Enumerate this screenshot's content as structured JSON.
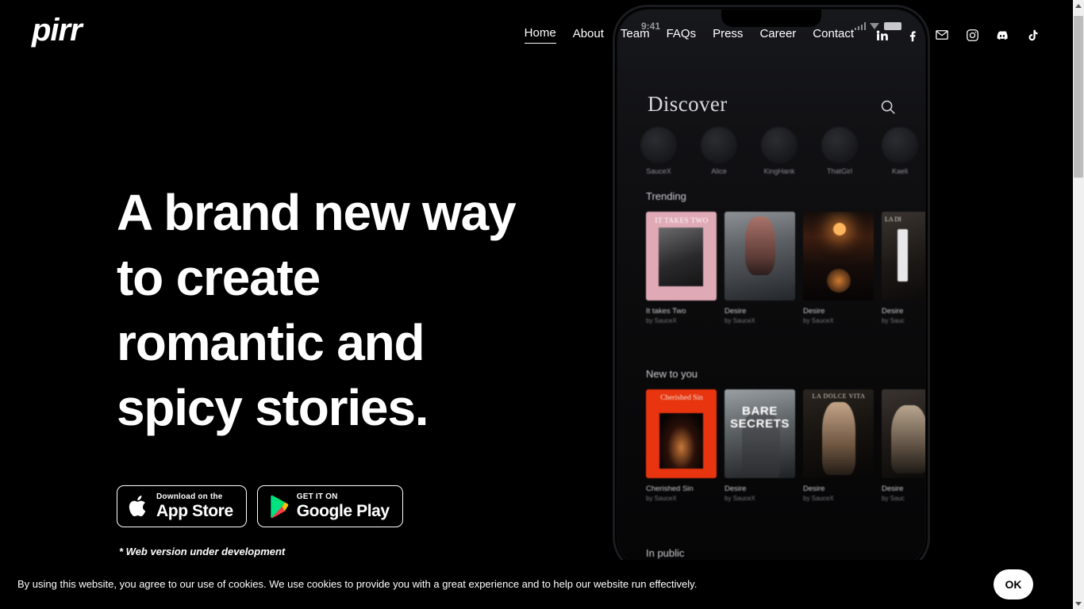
{
  "header": {
    "logo": "pirr",
    "nav": [
      {
        "label": "Home",
        "active": true
      },
      {
        "label": "About",
        "active": false
      },
      {
        "label": "Team",
        "active": false
      },
      {
        "label": "FAQs",
        "active": false
      },
      {
        "label": "Press",
        "active": false
      },
      {
        "label": "Career",
        "active": false
      },
      {
        "label": "Contact",
        "active": false
      }
    ],
    "socials": [
      {
        "name": "linkedin-icon",
        "label": "LinkedIn"
      },
      {
        "name": "facebook-icon",
        "label": "Facebook"
      },
      {
        "name": "email-icon",
        "label": "Email"
      },
      {
        "name": "instagram-icon",
        "label": "Instagram"
      },
      {
        "name": "discord-icon",
        "label": "Discord"
      },
      {
        "name": "tiktok-icon",
        "label": "TikTok"
      }
    ]
  },
  "hero": {
    "headline": "A brand new way to create romantic and spicy stories.",
    "note": "* Web version under development",
    "app_store": {
      "small": "Download on the",
      "large": "App Store",
      "icon": "apple-icon"
    },
    "google_play": {
      "small": "GET IT ON",
      "large": "Google Play",
      "icon": "google-play-icon"
    }
  },
  "phone": {
    "status": {
      "time": "9:41",
      "signal": "signal-icon",
      "wifi": "wifi-icon",
      "battery": "battery-icon"
    },
    "screen_title": "Discover",
    "search_icon": "search-icon",
    "creators": [
      "SauceX",
      "Alice",
      "KingHank",
      "ThatGirl",
      "Kaeli"
    ],
    "shelves": [
      {
        "title": "Trending",
        "books": [
          {
            "title": "It takes Two",
            "author": "by SauceX",
            "cover": "cv-pink",
            "cover_text": "IT TAKES TWO"
          },
          {
            "title": "Desire",
            "author": "by SauceX",
            "cover": "cv-gray",
            "cover_text": ""
          },
          {
            "title": "Desire",
            "author": "by SauceX",
            "cover": "cv-sunset",
            "cover_text": ""
          },
          {
            "title": "Desire",
            "author": "by Sauc",
            "cover": "cv-edge",
            "cover_text": "LA DI"
          }
        ]
      },
      {
        "title": "New to you",
        "books": [
          {
            "title": "Cherished Sin",
            "author": "by SauceX",
            "cover": "cv-red",
            "cover_text": "Cherished Sin"
          },
          {
            "title": "Desire",
            "author": "by SauceX",
            "cover": "cv-bare",
            "cover_text": "BARE SECRETS"
          },
          {
            "title": "Desire",
            "author": "by SauceX",
            "cover": "cv-dark",
            "cover_text": "LA DOLCE VITA"
          },
          {
            "title": "Desire",
            "author": "by Sauc",
            "cover": "cv-edge",
            "cover_text": ""
          }
        ]
      },
      {
        "title": "In public",
        "books": []
      }
    ]
  },
  "cookie": {
    "message": "By using this website, you agree to our use of cookies. We use cookies to provide you with a great experience and to help our website run effectively.",
    "accept_label": "OK"
  },
  "colors": {
    "background": "#000000",
    "text": "#ffffff",
    "cover_pink": "#dfaab6",
    "cover_red": "#e8340f",
    "scrollbar_thumb": "#bdbdbd"
  }
}
